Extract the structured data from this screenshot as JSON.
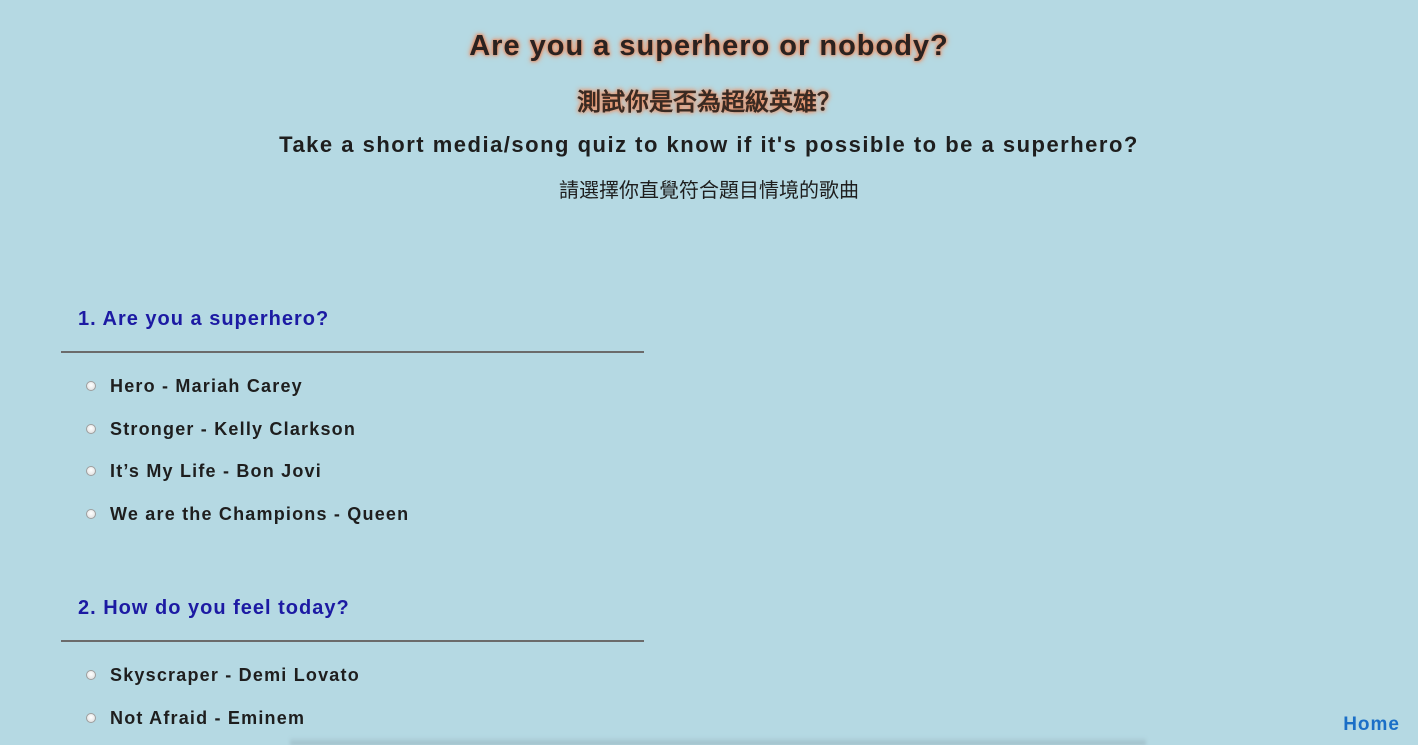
{
  "header": {
    "title_en": "Are you a superhero or nobody?",
    "title_zh": "測試你是否為超級英雄？",
    "subtitle_en": "Take a short media/song quiz to know if it's possible to be a superhero?",
    "subtitle_zh": "請選擇你直覺符合題目情境的歌曲"
  },
  "questions": [
    {
      "heading": "1. Are you a superhero?",
      "options": [
        "Hero - Mariah Carey",
        "Stronger - Kelly Clarkson",
        "It’s My Life - Bon Jovi",
        "We are the Champions - Queen"
      ]
    },
    {
      "heading": "2. How do you feel today?",
      "options": [
        "Skyscraper - Demi Lovato",
        "Not Afraid - Eminem"
      ]
    }
  ],
  "nav": {
    "home_label": "Home"
  },
  "colors": {
    "background": "#b5d9e3",
    "question_heading": "#1c1aa3",
    "link": "#1b6fc7",
    "title_glow": "#e8875a"
  }
}
